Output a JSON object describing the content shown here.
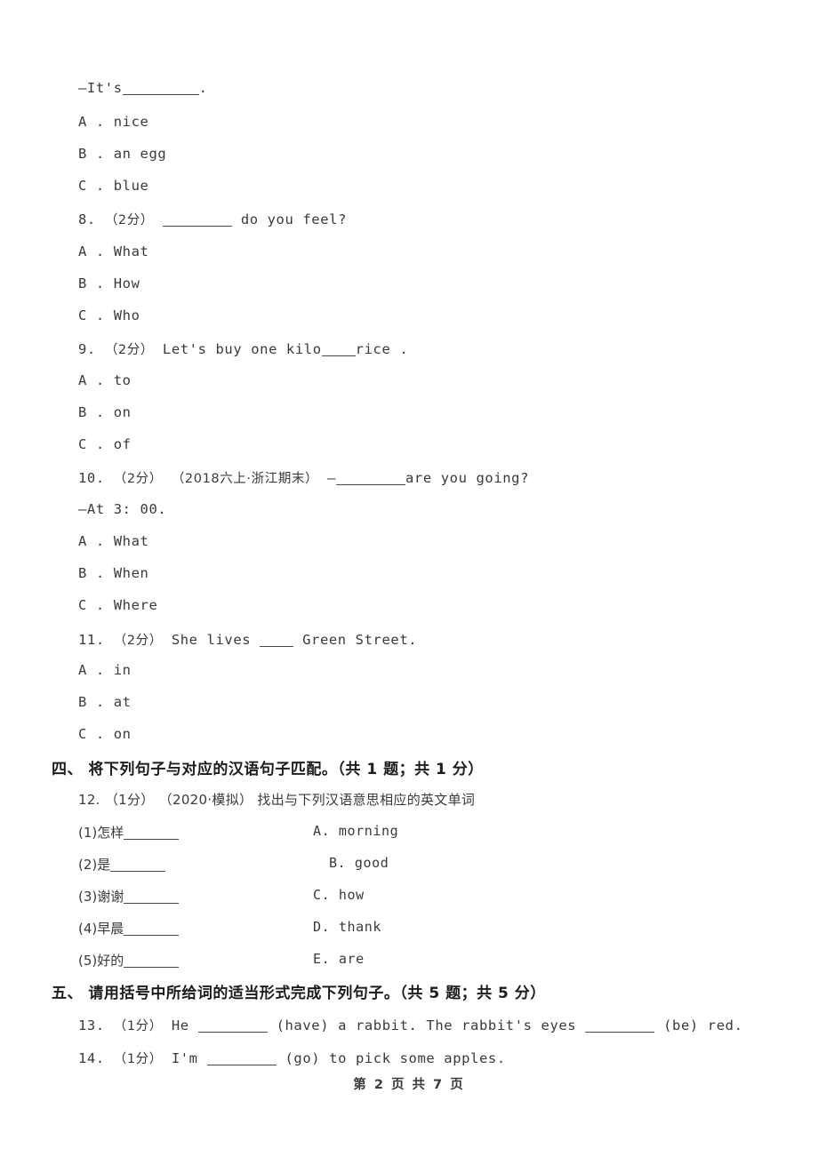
{
  "document": {
    "kind": "exam-paper",
    "footer": "第 2 页 共 7 页"
  },
  "carryover_question": {
    "stem": "—It's",
    "stem_tail": ".",
    "options": [
      "A . nice",
      "B . an egg",
      "C . blue"
    ]
  },
  "questions": [
    {
      "number": "8.",
      "marks": "（2分）",
      "stem_before": "",
      "stem_after": "do you feel?",
      "options": [
        "A . What",
        "B . How",
        "C . Who"
      ]
    },
    {
      "number": "9.",
      "marks": "（2分）",
      "stem_before": "Let's buy one kilo",
      "stem_after": "rice .",
      "options": [
        "A . to",
        "B . on",
        "C . of"
      ]
    },
    {
      "number": "10.",
      "marks": "（2分）",
      "source": "（2018六上·浙江期末）",
      "stem_before": "—",
      "stem_after": "are you going?",
      "continuation": "—At 3: 00.",
      "options": [
        "A . What",
        "B . When",
        "C . Where"
      ]
    },
    {
      "number": "11.",
      "marks": "（2分）",
      "stem_before": "She lives",
      "stem_after": "Green Street.",
      "options": [
        "A . in",
        "B . at",
        "C . on"
      ]
    }
  ],
  "section_four": {
    "heading": "四、 将下列句子与对应的汉语句子匹配。（共 1 题；共 1 分）",
    "question": {
      "number": "12.",
      "marks": "（1分）",
      "source": "（2020·模拟）",
      "prompt": "找出与下列汉语意思相应的英文单词"
    },
    "left_items": [
      "(1)怎样",
      "(2)是",
      "(3)谢谢",
      "(4)早晨",
      "(5)好的"
    ],
    "right_items": [
      "A. morning",
      "B. good",
      "C. how",
      "D. thank",
      "E. are"
    ]
  },
  "section_five": {
    "heading": "五、 请用括号中所给词的适当形式完成下列句子。（共 5 题；共 5 分）",
    "questions": [
      {
        "number": "13.",
        "marks": "（1分）",
        "part_a": "He",
        "part_b": "(have) a rabbit. The rabbit's eyes",
        "part_c": "(be) red."
      },
      {
        "number": "14.",
        "marks": "（1分）",
        "part_a": "I'm",
        "part_b": "(go) to pick some apples."
      }
    ]
  }
}
